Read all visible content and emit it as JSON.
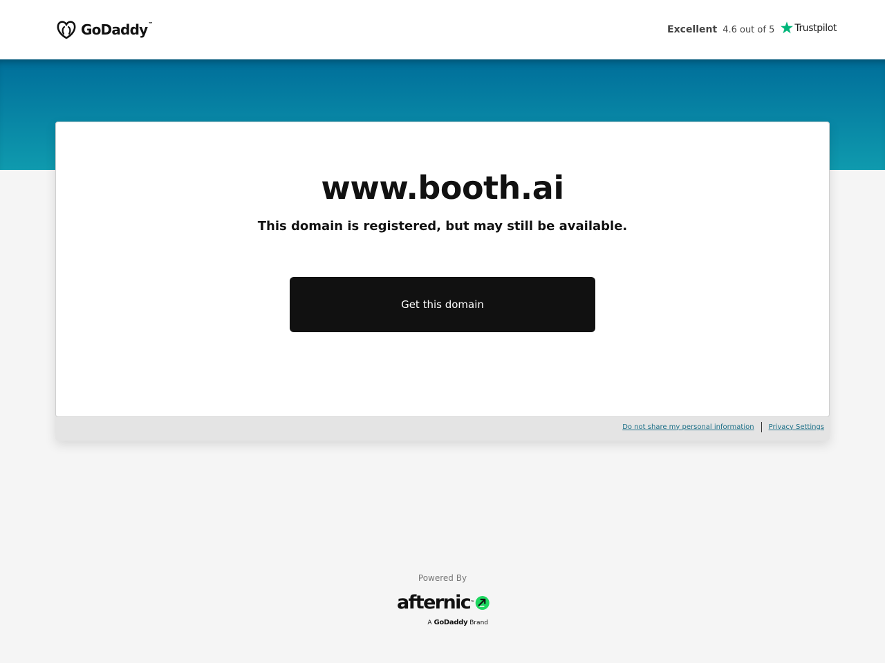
{
  "header": {
    "logo_text": "GoDaddy",
    "logo_trademark": "™",
    "trustpilot": {
      "rating_word": "Excellent",
      "score_text": "4.6 out of 5",
      "brand": "Trustpilot",
      "star_color": "#00b67a"
    }
  },
  "main": {
    "domain": "www.booth.ai",
    "subtitle": "This domain is registered, but may still be available.",
    "cta_label": "Get this domain"
  },
  "footer": {
    "do_not_share": "Do not share my personal information",
    "privacy_settings": "Privacy Settings"
  },
  "powered": {
    "label": "Powered By",
    "brand_word": "afternic",
    "brand_trademark": "™",
    "brand_prefix": "A",
    "brand_parent": "GoDaddy",
    "brand_suffix": "Brand",
    "brand_icon_color": "#1ed760"
  },
  "colors": {
    "banner_top": "#006e9a",
    "banner_bottom": "#0f9aae",
    "cta_background": "#111111",
    "link": "#1b6f87"
  }
}
